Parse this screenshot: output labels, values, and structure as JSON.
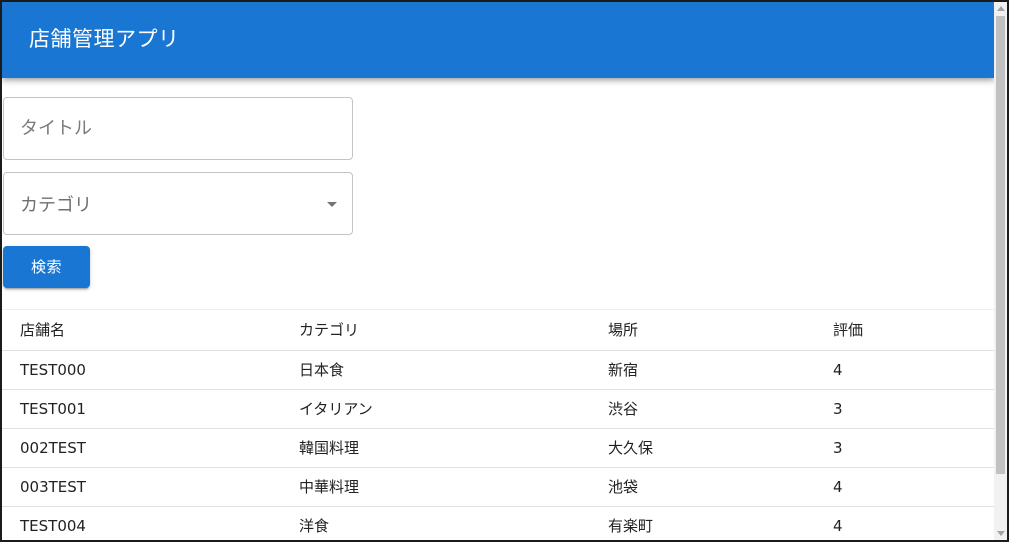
{
  "app": {
    "title": "店舗管理アプリ"
  },
  "search": {
    "title_placeholder": "タイトル",
    "category_label": "カテゴリ",
    "category_value": "",
    "search_button": "検索"
  },
  "table": {
    "headers": [
      "店舗名",
      "カテゴリ",
      "場所",
      "評価"
    ],
    "rows": [
      [
        "TEST000",
        "日本食",
        "新宿",
        "4"
      ],
      [
        "TEST001",
        "イタリアン",
        "渋谷",
        "3"
      ],
      [
        "002TEST",
        "韓国料理",
        "大久保",
        "3"
      ],
      [
        "003TEST",
        "中華料理",
        "池袋",
        "4"
      ],
      [
        "TEST004",
        "洋食",
        "有楽町",
        "4"
      ]
    ]
  },
  "colors": {
    "primary": "#1976d2",
    "appbar_text": "#ffffff"
  },
  "icons": {
    "select_caret": "chevron-down-icon"
  }
}
